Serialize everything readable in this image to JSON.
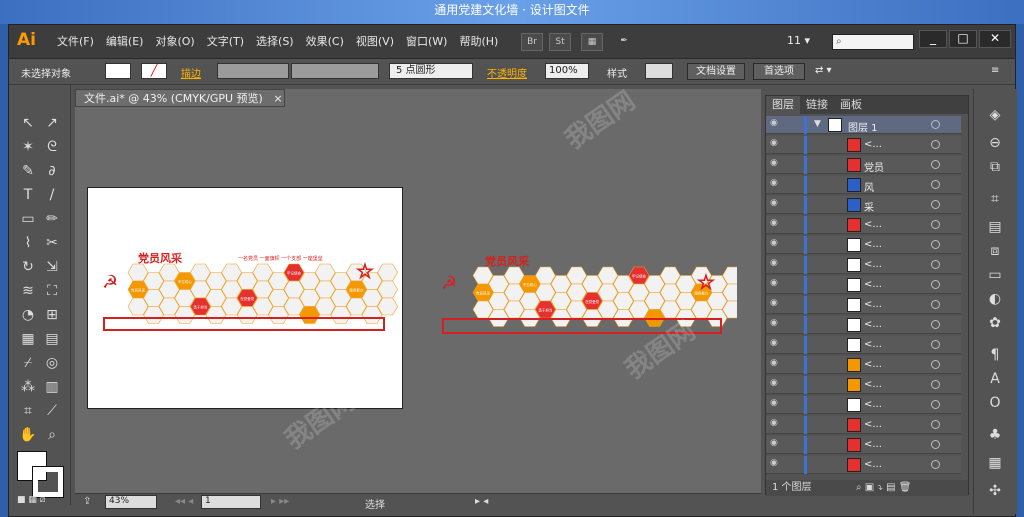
{
  "banner": "通用党建文化墙 · 设计图文件",
  "app": {
    "logo": "Ai",
    "menu": [
      "文件(F)",
      "编辑(E)",
      "对象(O)",
      "文字(T)",
      "选择(S)",
      "效果(C)",
      "视图(V)",
      "窗口(W)",
      "帮助(H)"
    ],
    "toolbar_icons": [
      "Br",
      "St"
    ],
    "zoom": "11",
    "search_placeholder": "",
    "win": [
      "_",
      "□",
      "✕"
    ]
  },
  "control": {
    "no_selection": "未选择对象",
    "stroke_label": "描边",
    "point": "5 点圆形",
    "opacity_label": "不透明度",
    "opacity": "100%",
    "style_label": "样式",
    "doc_setup": "文档设置",
    "prefs": "首选项"
  },
  "doc": {
    "tab": "文件.ai* @ 43% (CMYK/GPU 预览)",
    "close": "×",
    "art": {
      "title": "党员风采",
      "slogan": "一名党员 一面旗帜 一个支部 一座堡垒",
      "hex_labels": [
        "不忘初心",
        "牢记使命",
        "党员风采",
        "在党爱党",
        "服务群众",
        "勇于担当"
      ]
    }
  },
  "status": {
    "zoom": "43%",
    "page": "1",
    "mode": "选择"
  },
  "layers": {
    "tabs": [
      "图层",
      "链接",
      "画板"
    ],
    "layer_name": "图层 1",
    "count": "1 个图层",
    "items": [
      {
        "label": "<...",
        "color": "#e53030"
      },
      {
        "label": "党员",
        "color": "#e53030"
      },
      {
        "label": "风",
        "color": "#2a60c8"
      },
      {
        "label": "采",
        "color": "#2a60c8"
      },
      {
        "label": "<...",
        "color": "#e53030"
      },
      {
        "label": "<...",
        "color": "#ffffff"
      },
      {
        "label": "<...",
        "color": "#ffffff"
      },
      {
        "label": "<...",
        "color": "#ffffff"
      },
      {
        "label": "<...",
        "color": "#ffffff"
      },
      {
        "label": "<...",
        "color": "#ffffff"
      },
      {
        "label": "<...",
        "color": "#ffffff"
      },
      {
        "label": "<...",
        "color": "#f39800"
      },
      {
        "label": "<...",
        "color": "#f39800"
      },
      {
        "label": "<...",
        "color": "#ffffff"
      },
      {
        "label": "<...",
        "color": "#e53030"
      },
      {
        "label": "<...",
        "color": "#e53030"
      },
      {
        "label": "<...",
        "color": "#e53030"
      }
    ]
  },
  "watermark": "我图网"
}
